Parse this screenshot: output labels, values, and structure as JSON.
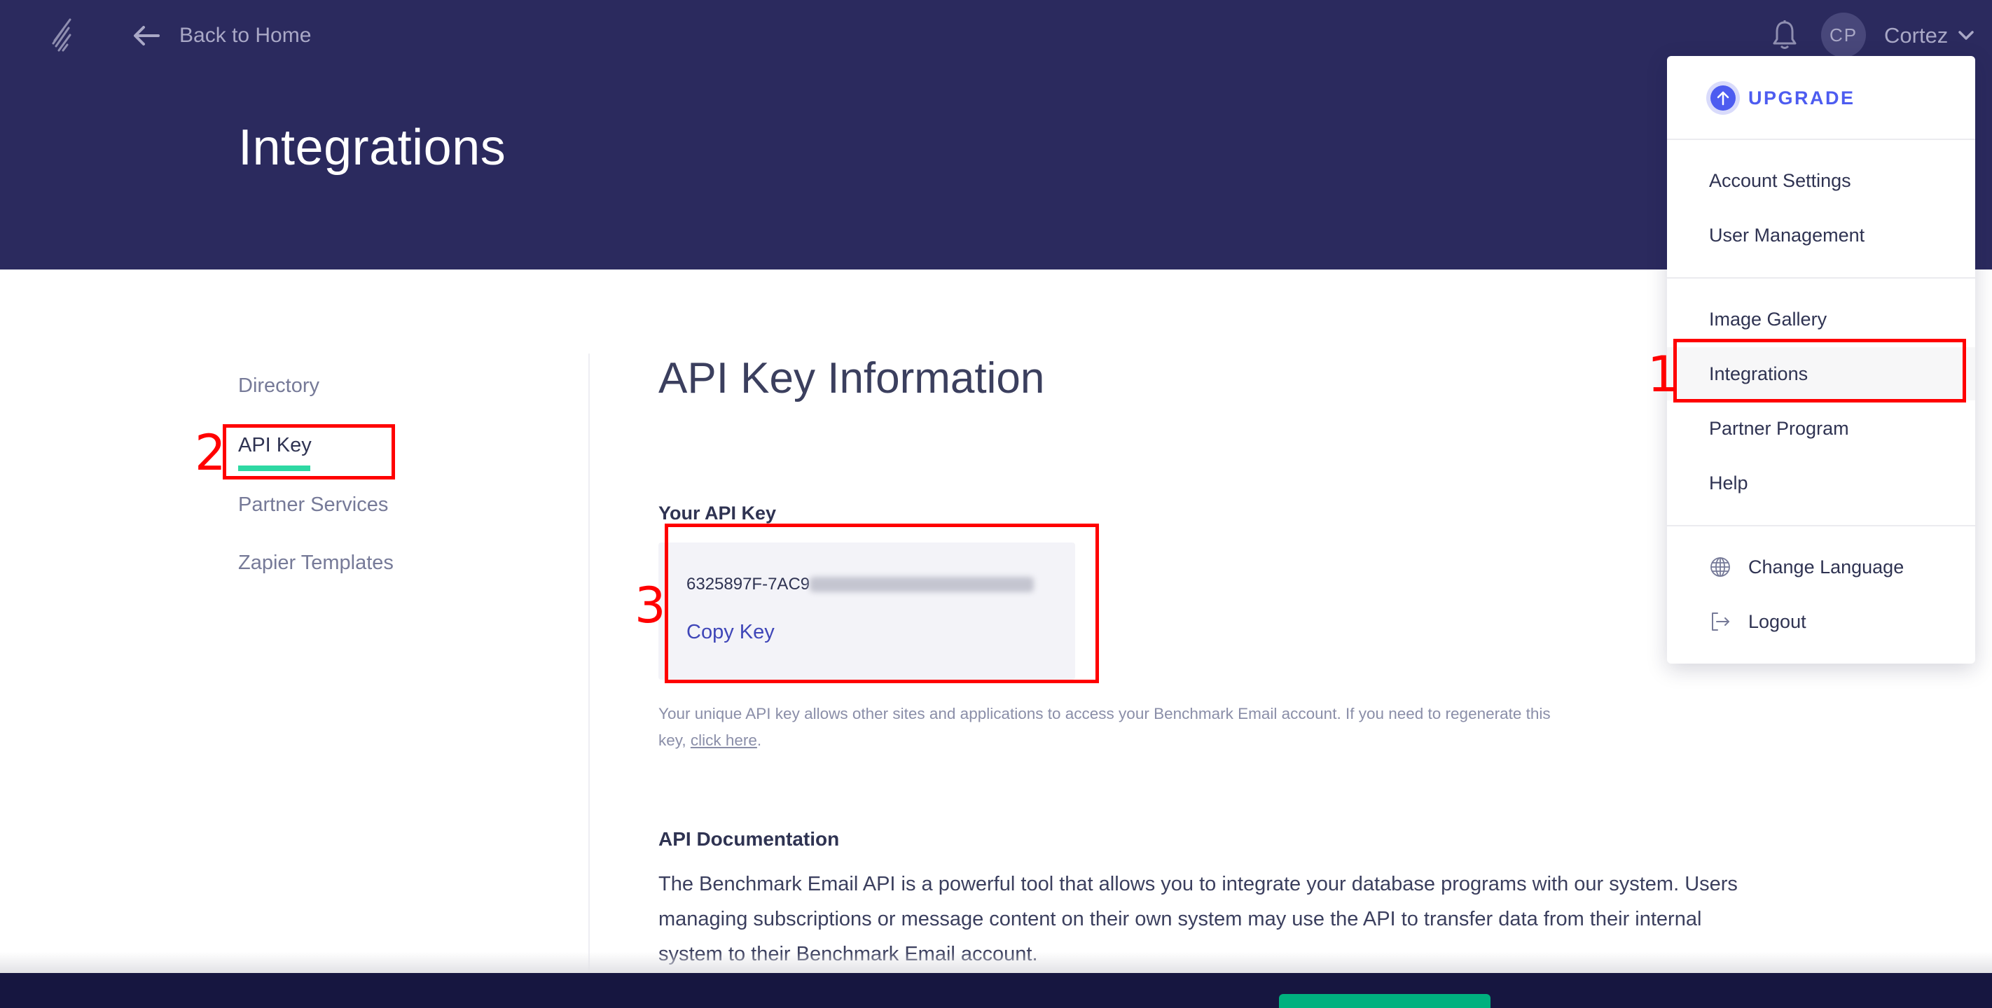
{
  "topbar": {
    "logo_icon": "benchmark-logo-icon",
    "back_icon": "arrow-left-icon",
    "back_label": "Back to Home",
    "bell_icon": "bell-icon",
    "avatar_initials": "CP",
    "user_name": "Cortez",
    "user_chevron_icon": "chevron-down-icon"
  },
  "header": {
    "title": "Integrations"
  },
  "sidebar": {
    "items": [
      {
        "label": "Directory",
        "active": false
      },
      {
        "label": "API Key",
        "active": true
      },
      {
        "label": "Partner Services",
        "active": false
      },
      {
        "label": "Zapier Templates",
        "active": false
      }
    ]
  },
  "main": {
    "heading": "API Key Information",
    "key_label": "Your API Key",
    "key_visible_prefix": "6325897F-7AC9",
    "key_redacted": true,
    "copy_key_label": "Copy Key",
    "help_text_prefix": "Your unique API key allows other sites and applications to access your Benchmark Email account. If you need to regenerate this key, ",
    "help_link": "click here",
    "help_text_suffix": ".",
    "doc_heading": "API Documentation",
    "doc_text": "The Benchmark Email API is a powerful tool that allows you to integrate your database programs with our system. Users managing subscriptions or message content on their own system may use the API to transfer data from their internal system to their Benchmark Email account."
  },
  "dropdown": {
    "upgrade_icon": "arrow-up-circle-icon",
    "upgrade_label": "UPGRADE",
    "group1": [
      "Account Settings",
      "User Management"
    ],
    "group2": [
      "Image Gallery",
      "Integrations",
      "Partner Program",
      "Help"
    ],
    "active_item": "Integrations",
    "group3": [
      {
        "label": "Change Language",
        "icon": "globe-icon"
      },
      {
        "label": "Logout",
        "icon": "logout-icon"
      }
    ]
  },
  "annotations": [
    {
      "number": "1",
      "target": "Integrations menu item"
    },
    {
      "number": "2",
      "target": "API Key sidebar item"
    },
    {
      "number": "3",
      "target": "API key box"
    }
  ],
  "colors": {
    "header_bg": "#2b2a5e",
    "footer_bg": "#161640",
    "accent_green": "#2ed8a3",
    "footer_button": "#00b17f",
    "upgrade_blue": "#4d5cf0",
    "link_blue": "#3f46b8",
    "annotation_red": "#ff0000"
  }
}
